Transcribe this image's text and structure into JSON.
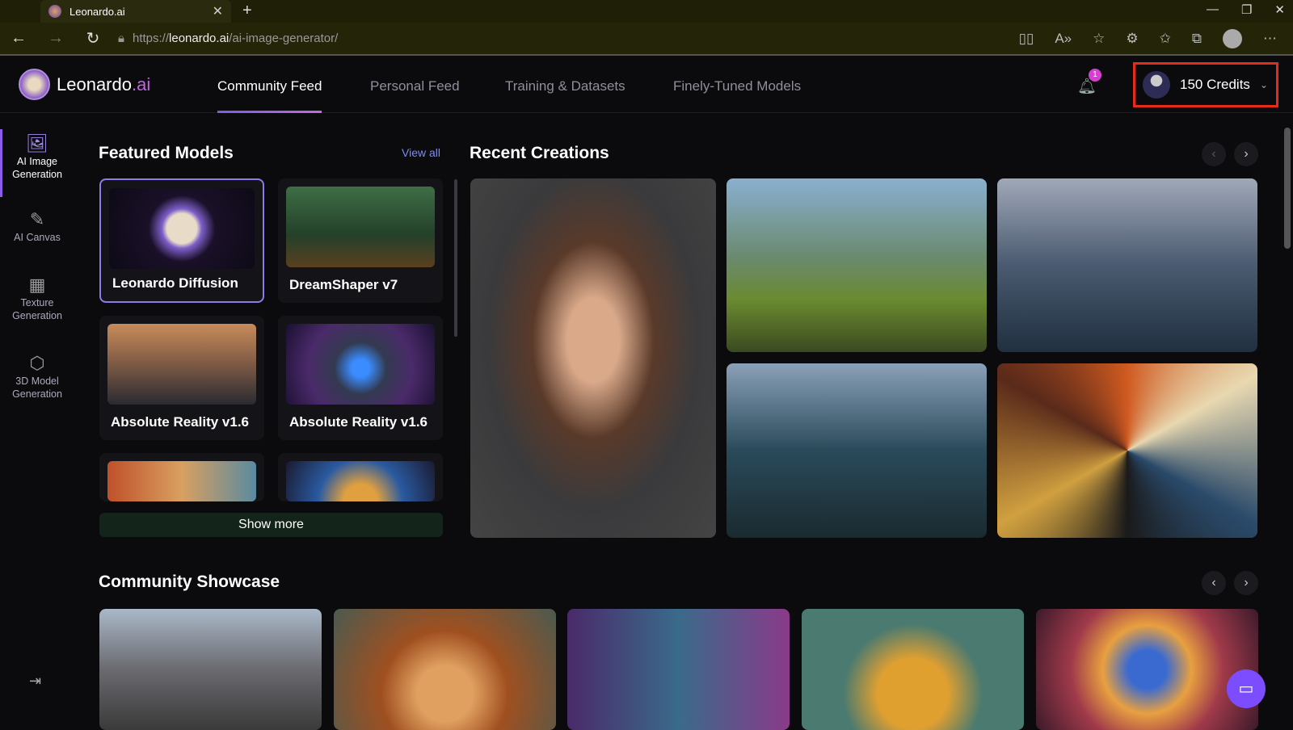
{
  "browser": {
    "tab_title": "Leonardo.ai",
    "url_prefix": "https://",
    "url_domain": "leonardo.ai",
    "url_path": "/ai-image-generator/"
  },
  "header": {
    "logo_main": "Leonardo",
    "logo_suffix": ".ai",
    "tabs": [
      {
        "label": "Community Feed"
      },
      {
        "label": "Personal Feed"
      },
      {
        "label": "Training & Datasets"
      },
      {
        "label": "Finely-Tuned Models"
      }
    ],
    "notification_count": "1",
    "credits": "150 Credits"
  },
  "sidebar": {
    "items": [
      {
        "label": "AI Image Generation"
      },
      {
        "label": "AI Canvas"
      },
      {
        "label": "Texture Generation"
      },
      {
        "label": "3D Model Generation"
      }
    ]
  },
  "featured": {
    "title": "Featured Models",
    "view_all": "View all",
    "models": [
      {
        "name": "Leonardo Diffusion"
      },
      {
        "name": "DreamShaper v7"
      },
      {
        "name": "Absolute Reality v1.6"
      },
      {
        "name": "Absolute Reality v1.6"
      }
    ],
    "show_more": "Show more"
  },
  "recent": {
    "title": "Recent Creations"
  },
  "showcase": {
    "title": "Community Showcase"
  }
}
